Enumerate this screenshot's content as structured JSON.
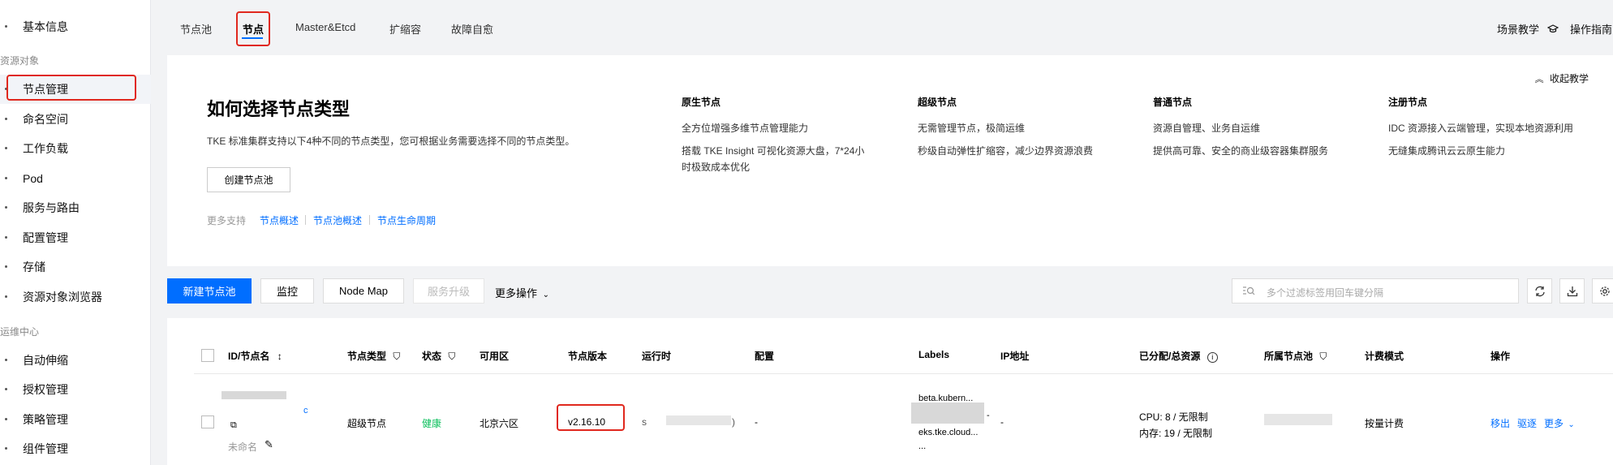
{
  "sidebar": {
    "top_item": "基本信息",
    "group1": "资源对象",
    "items1": [
      "节点管理",
      "命名空间",
      "工作负载",
      "Pod",
      "服务与路由",
      "配置管理",
      "存储",
      "资源对象浏览器"
    ],
    "group2": "运维中心",
    "items2": [
      "自动伸缩",
      "授权管理",
      "策略管理",
      "组件管理"
    ]
  },
  "tabs": [
    "节点池",
    "节点",
    "Master&Etcd",
    "扩缩容",
    "故障自愈"
  ],
  "top_right": {
    "tutorial": "场景教学",
    "guide": "操作指南"
  },
  "guide": {
    "title": "如何选择节点类型",
    "desc": "TKE 标准集群支持以下4种不同的节点类型，您可根据业务需要选择不同的节点类型。",
    "create_btn": "创建节点池",
    "more_support": "更多支持",
    "links": [
      "节点概述",
      "节点池概述",
      "节点生命周期"
    ],
    "collapse": "收起教学",
    "columns": [
      {
        "title": "原生节点",
        "lines": [
          "全方位增强多维节点管理能力",
          "搭载 TKE Insight 可视化资源大盘，7*24小",
          "时极致成本优化"
        ]
      },
      {
        "title": "超级节点",
        "lines": [
          "无需管理节点，极简运维",
          "秒级自动弹性扩缩容，减少边界资源浪费"
        ]
      },
      {
        "title": "普通节点",
        "lines": [
          "资源自管理、业务自运维",
          "提供高可靠、安全的商业级容器集群服务"
        ]
      },
      {
        "title": "注册节点",
        "lines": [
          "IDC 资源接入云端管理，实现本地资源利用",
          "无缝集成腾讯云云原生能力"
        ]
      }
    ]
  },
  "toolbar": {
    "new_pool": "新建节点池",
    "monitor": "监控",
    "node_map": "Node Map",
    "upgrade": "服务升级",
    "more_ops": "更多操作",
    "search_placeholder": "多个过滤标签用回车键分隔"
  },
  "table": {
    "headers": [
      "ID/节点名",
      "节点类型",
      "状态",
      "可用区",
      "节点版本",
      "运行时",
      "配置",
      "Labels",
      "IP地址",
      "已分配/总资源",
      "所属节点池",
      "计费模式",
      "操作"
    ],
    "row": {
      "id_suffix": "c",
      "unnamed": "未命名",
      "type": "超级节点",
      "status": "健康",
      "zone": "北京六区",
      "version": "v2.16.10",
      "runtime_prefix": "s",
      "runtime_suffix": ")",
      "config": "-",
      "labels": [
        "beta.kubern...",
        "-",
        "eks.tke.cloud...",
        "..."
      ],
      "ip": "-",
      "cpu": "CPU: 8 / 无限制",
      "mem": "内存: 19 / 无限制",
      "billing": "按量计费",
      "actions": [
        "移出",
        "驱逐",
        "更多"
      ]
    }
  },
  "colors": {
    "accent": "#006eff",
    "highlight": "#e0281e",
    "healthy": "#0abf5b"
  }
}
